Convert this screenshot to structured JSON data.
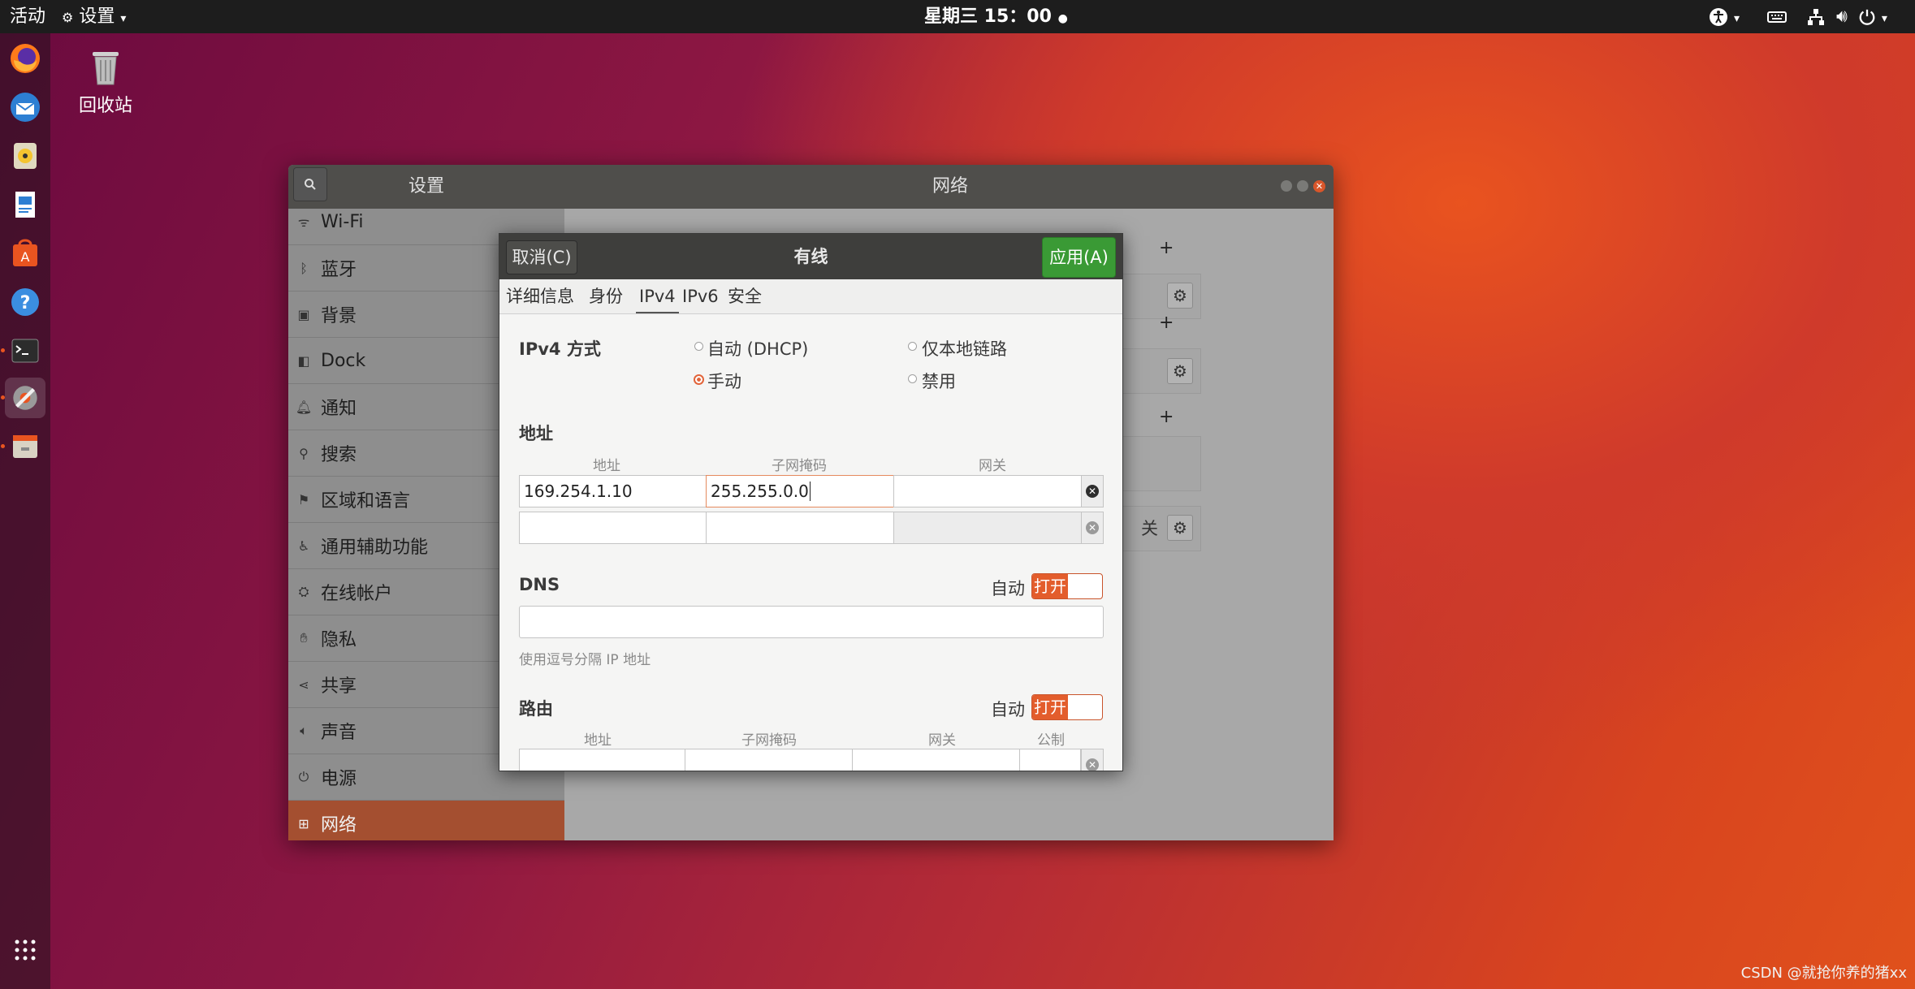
{
  "topbar": {
    "activities": "活动",
    "app_menu": "设置",
    "clock": "星期三 15：00"
  },
  "desktop": {
    "trash_label": "回收站"
  },
  "settings_window": {
    "sidebar_title": "设置",
    "panel_title": "网络",
    "sidebar_items": [
      {
        "label": "Wi-Fi",
        "icon": "wifi-icon"
      },
      {
        "label": "蓝牙",
        "icon": "bluetooth-icon"
      },
      {
        "label": "背景",
        "icon": "background-icon"
      },
      {
        "label": "Dock",
        "icon": "dock-icon"
      },
      {
        "label": "通知",
        "icon": "bell-icon"
      },
      {
        "label": "搜索",
        "icon": "search-icon"
      },
      {
        "label": "区域和语言",
        "icon": "flag-icon"
      },
      {
        "label": "通用辅助功能",
        "icon": "accessibility-icon"
      },
      {
        "label": "在线帐户",
        "icon": "online-accounts-icon"
      },
      {
        "label": "隐私",
        "icon": "hand-icon"
      },
      {
        "label": "共享",
        "icon": "share-icon"
      },
      {
        "label": "声音",
        "icon": "speaker-icon"
      },
      {
        "label": "电源",
        "icon": "power-icon"
      },
      {
        "label": "网络",
        "icon": "network-icon"
      }
    ],
    "behind_text": "关"
  },
  "dialog": {
    "cancel_label": "取消(C)",
    "title": "有线",
    "apply_label": "应用(A)",
    "tabs": [
      "详细信息",
      "身份",
      "IPv4",
      "IPv6",
      "安全"
    ],
    "method_label": "IPv4 方式",
    "methods": {
      "dhcp": "自动 (DHCP)",
      "link_local": "仅本地链路",
      "manual": "手动",
      "disable": "禁用"
    },
    "address_section": "地址",
    "address_headers": [
      "地址",
      "子网掩码",
      "网关"
    ],
    "address_row": {
      "address": "169.254.1.10",
      "netmask": "255.255.0.0",
      "gateway": ""
    },
    "dns_label": "DNS",
    "dns_auto_label": "自动",
    "dns_switch": "打开",
    "dns_hint": "使用逗号分隔 IP 地址",
    "routes_label": "路由",
    "routes_auto_label": "自动",
    "routes_switch": "打开",
    "route_headers": [
      "地址",
      "子网掩码",
      "网关",
      "公制"
    ]
  },
  "watermark": "CSDN @就抢你养的猪xx",
  "colors": {
    "accent": "#e95420",
    "apply_green": "#3a9a35",
    "selected_sidebar": "#a44f30"
  }
}
